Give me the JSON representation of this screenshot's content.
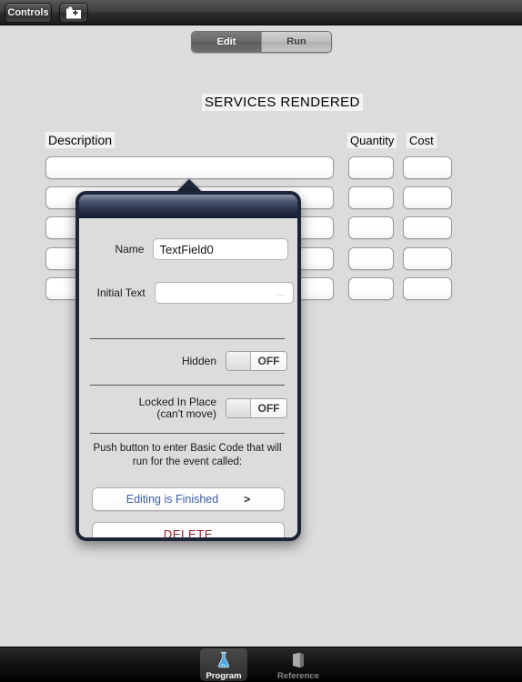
{
  "toolbar": {
    "controls_label": "Controls",
    "new_file_icon": "folder-add-icon"
  },
  "mode_switch": {
    "edit_label": "Edit",
    "run_label": "Run",
    "selected": "Edit"
  },
  "canvas": {
    "title": "SERVICES RENDERED",
    "headers": {
      "description": "Description",
      "quantity": "Quantity",
      "cost": "Cost"
    },
    "rows": [
      {
        "description": "",
        "quantity": "",
        "cost": ""
      },
      {
        "description": "",
        "quantity": "",
        "cost": ""
      },
      {
        "description": "",
        "quantity": "",
        "cost": ""
      },
      {
        "description": "",
        "quantity": "",
        "cost": ""
      },
      {
        "description": "",
        "quantity": "",
        "cost": ""
      }
    ]
  },
  "popover": {
    "name_label": "Name",
    "name_value": "TextField0",
    "initial_text_label": "Initial Text",
    "initial_text_value": "",
    "initial_text_ellipsis": "...",
    "hidden_label": "Hidden",
    "hidden_state": "OFF",
    "locked_label_line1": "Locked In Place",
    "locked_label_line2": "(can't move)",
    "locked_state": "OFF",
    "hint_line1": "Push button to enter Basic Code that will",
    "hint_line2": "run for the event called:",
    "event_button_label": "Editing is Finished",
    "event_button_chevron": ">",
    "delete_button_label": "DELETE"
  },
  "tabbar": {
    "program_label": "Program",
    "program_icon": "flask-icon",
    "reference_label": "Reference",
    "reference_icon": "book-icon",
    "selected": "Program"
  },
  "colors": {
    "background": "#dcdcdc",
    "popover_border": "#1c2438",
    "event_link": "#3b5ea8",
    "delete_red": "#a01b2a",
    "flask_blue": "#4aa8e0"
  }
}
